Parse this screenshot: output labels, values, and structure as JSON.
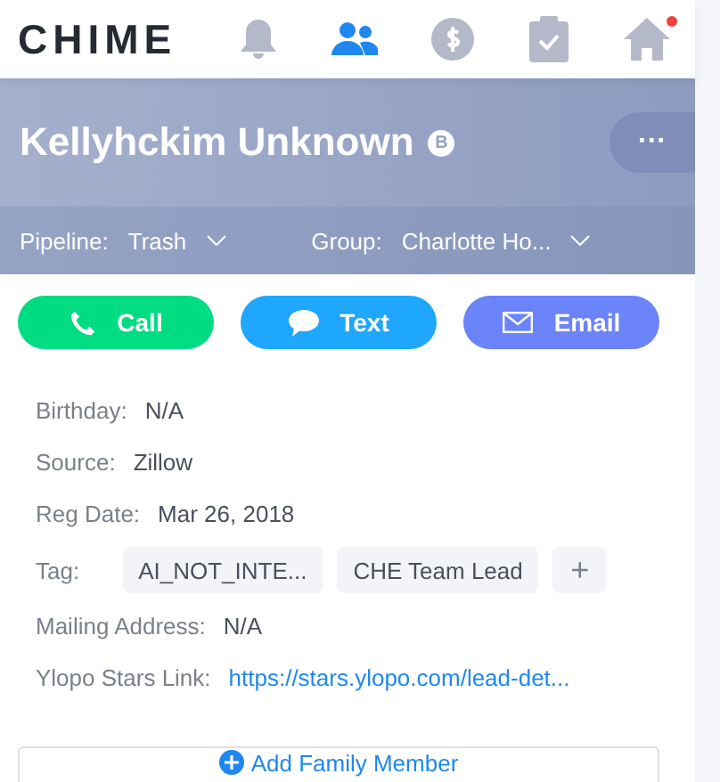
{
  "nav": {
    "logo": "CHIME",
    "items": [
      {
        "kind": "bell",
        "selected": false
      },
      {
        "kind": "people",
        "selected": true
      },
      {
        "kind": "dollar",
        "selected": false
      },
      {
        "kind": "clipboard",
        "selected": false
      },
      {
        "kind": "home",
        "selected": false,
        "notification": true
      }
    ]
  },
  "header": {
    "name": "Kellyhckim Unknown",
    "badge": "B",
    "more": "···",
    "pipeline": {
      "label": "Pipeline:",
      "value": "Trash"
    },
    "group": {
      "label": "Group:",
      "value": "Charlotte Ho..."
    }
  },
  "actions": [
    {
      "kind": "call",
      "label": "Call",
      "color": "#00dc82"
    },
    {
      "kind": "text",
      "label": "Text",
      "color": "#1ea7fd"
    },
    {
      "kind": "email",
      "label": "Email",
      "color": "#6b84fa"
    }
  ],
  "fields": [
    {
      "kind": "text",
      "label": "Birthday:",
      "value": "N/A"
    },
    {
      "kind": "text",
      "label": "Source:",
      "value": "Zillow"
    },
    {
      "kind": "text",
      "label": "Reg Date:",
      "value": "Mar 26, 2018"
    },
    {
      "kind": "tags",
      "label": "Tag:",
      "tags": [
        "AI_NOT_INTE...",
        "CHE Team Lead"
      ],
      "add": "+"
    },
    {
      "kind": "text",
      "label": "Mailing Address:",
      "value": "N/A"
    },
    {
      "kind": "link",
      "label": "Ylopo Stars Link:",
      "value": "https://stars.ylopo.com/lead-det..."
    }
  ],
  "add_family": {
    "label": "Add Family Member"
  }
}
